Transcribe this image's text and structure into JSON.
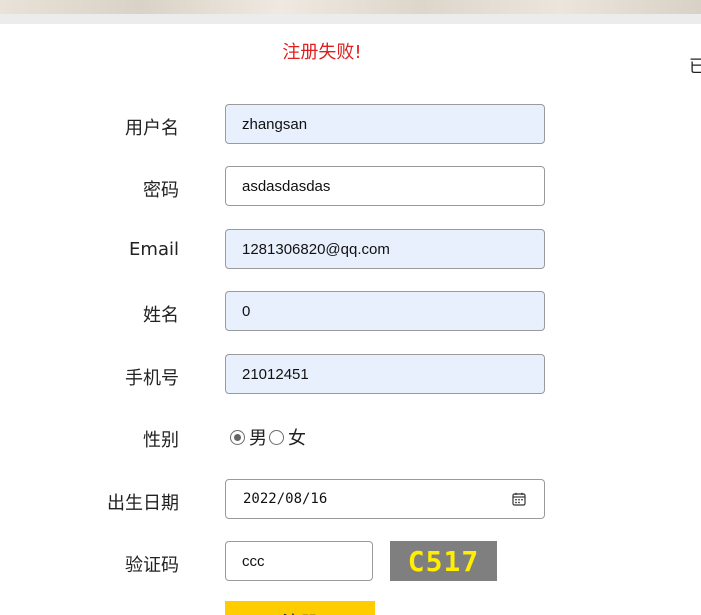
{
  "page": {
    "error_message": "注册失败!",
    "right_edge_text": "已"
  },
  "form": {
    "username": {
      "label": "用户名",
      "value": "zhangsan"
    },
    "password": {
      "label": "密码",
      "value": "asdasdasdas"
    },
    "email": {
      "label": "Email",
      "value": "1281306820@qq.com"
    },
    "name": {
      "label": "姓名",
      "value": "0"
    },
    "phone": {
      "label": "手机号",
      "value": "21012451"
    },
    "gender": {
      "label": "性别",
      "options": [
        "男",
        "女"
      ],
      "selected": "男"
    },
    "birthday": {
      "label": "出生日期",
      "value": "2022/08/16"
    },
    "captcha": {
      "label": "验证码",
      "value": "ccc",
      "image_text": "C517"
    },
    "submit_label": "注册"
  },
  "colors": {
    "error": "#e02020",
    "autofill_bg": "#e8f0fe",
    "submit_bg": "#ffcc00",
    "captcha_bg": "#7f7f7f",
    "captcha_text": "#ffee00"
  },
  "icons": {
    "date_picker": "calendar-icon"
  }
}
